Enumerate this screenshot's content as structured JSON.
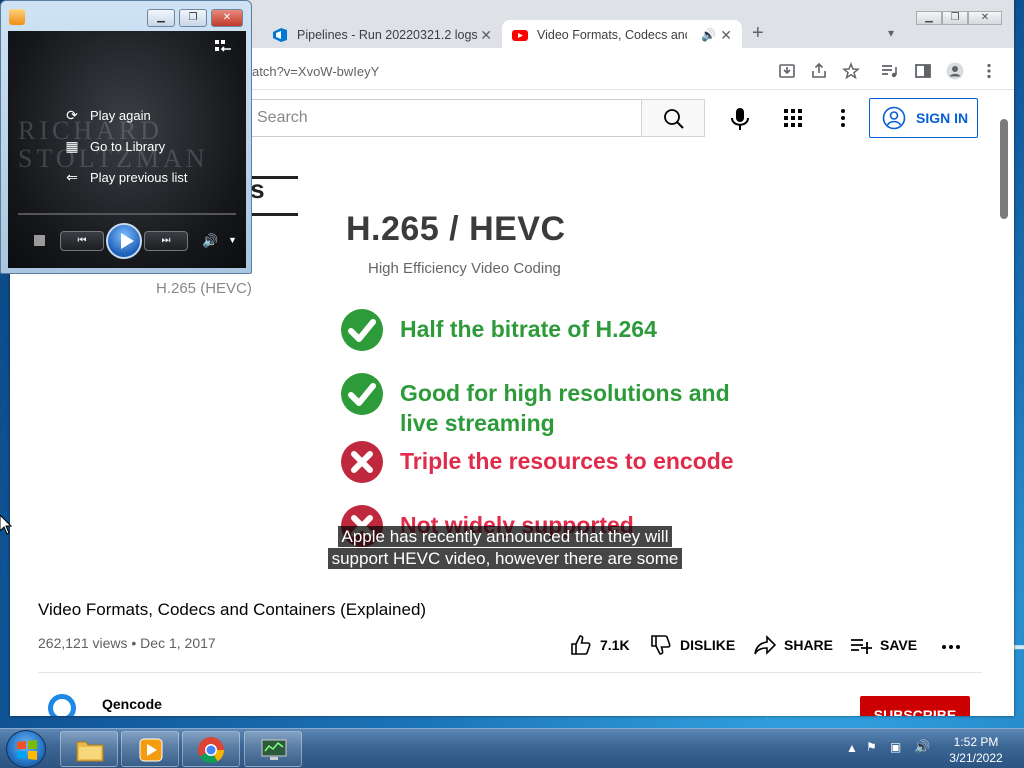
{
  "browser": {
    "tabs": [
      {
        "title": "Pipelines - Run 20220321.2 logs",
        "active": false
      },
      {
        "title": "Video Formats, Codecs and C",
        "active": true
      }
    ],
    "new_tab": "+",
    "url": "atch?v=XvoW-bwIeyY"
  },
  "youtube": {
    "search_placeholder": "Search",
    "sign_in": "SIGN IN",
    "slide": {
      "header_fragment": "rs",
      "left_label": "H.265 (HEVC)",
      "title": "H.265  /  HEVC",
      "subtitle": "High Efficiency Video Coding",
      "bullets": [
        {
          "text": "Half the bitrate of H.264",
          "kind": "pro"
        },
        {
          "text": "Good for high resolutions and live streaming",
          "kind": "pro"
        },
        {
          "text": "Triple the resources to encode",
          "kind": "con"
        },
        {
          "text": "Not widely supported",
          "kind": "con"
        }
      ],
      "colors": {
        "pro": "#2e9b3a",
        "con": "#e02b4b"
      }
    },
    "caption_line1": "Apple has recently announced that they will",
    "caption_line2": "support HEVC video, however there are some",
    "video_title": "Video Formats, Codecs and Containers (Explained)",
    "meta": "262,121 views • Dec 1, 2017",
    "actions": {
      "like": "7.1K",
      "dislike": "DISLIKE",
      "share": "SHARE",
      "save": "SAVE"
    },
    "channel": "Qencode",
    "subscribe": "SUBSCRIBE"
  },
  "wmp": {
    "menu": [
      {
        "label": "Play again",
        "icon": "replay-icon"
      },
      {
        "label": "Go to Library",
        "icon": "library-icon"
      },
      {
        "label": "Play previous list",
        "icon": "back-arrow-icon"
      }
    ],
    "bg_text_line1": "RICHARD",
    "bg_text_line2": "STOLTZMAN"
  },
  "taskbar": {
    "time": "1:52 PM",
    "date": "3/21/2022"
  }
}
